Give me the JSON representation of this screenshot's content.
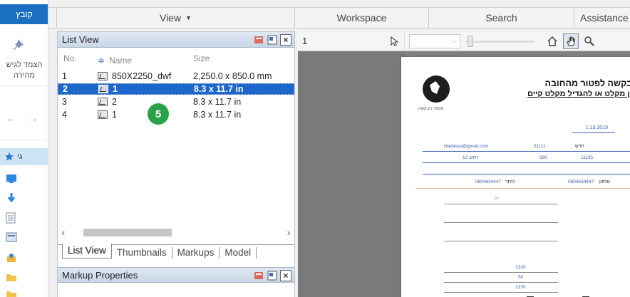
{
  "explorer": {
    "ribbon_tab": "קובץ",
    "pin_label_line1": "הצמד לגיש",
    "pin_label_line2": "מהירה",
    "quick_access_label": "גי"
  },
  "menubar": {
    "view": "View",
    "workspace": "Workspace",
    "search": "Search",
    "assistance": "Assistance"
  },
  "list_panel": {
    "title": "List View",
    "columns": {
      "no": "No.",
      "name": "Name",
      "size": "Size"
    },
    "rows": [
      {
        "no": "1",
        "name": "850X2250_dwf",
        "size": "2,250.0 x 850.0 mm"
      },
      {
        "no": "2",
        "name": "1",
        "size": "8.3 x 11.7 in"
      },
      {
        "no": "3",
        "name": "2",
        "size": "8.3 x 11.7 in"
      },
      {
        "no": "4",
        "name": "1",
        "size": "8.3 x 11.7 in"
      }
    ],
    "selected_row": 1,
    "callout_badge": "5",
    "tabs": [
      "List View",
      "Thumbnails",
      "Markups",
      "Model"
    ],
    "active_tab": "List View"
  },
  "markup_panel": {
    "title": "Markup Properties"
  },
  "viewer": {
    "page_number": "1",
    "document": {
      "heading": "בקשה לפטור מהחובה",
      "subheading": "ין מקלט או להגדיל מקלט קיים",
      "logo_caption": "מספר הבקשה",
      "date": "1.10.2019",
      "email": "Hadasso@gmail.com",
      "field_a": "51111",
      "field_b": "280",
      "field_c": "11195",
      "field_d": "13 רחוב",
      "field_e": "0804634447",
      "field_f": "0804634447",
      "field_g": "10",
      "field_h": "1320",
      "field_i": "50",
      "field_j": "1370",
      "label_a": "חדש",
      "label_b": "היתר",
      "label_c": "טלפון"
    }
  },
  "colors": {
    "selection": "#1d66cc",
    "badge": "#2aa24a",
    "ribbon": "#1a6fc0",
    "panel_title": "#c9d6e6",
    "doc_blue": "#3a63b0"
  }
}
